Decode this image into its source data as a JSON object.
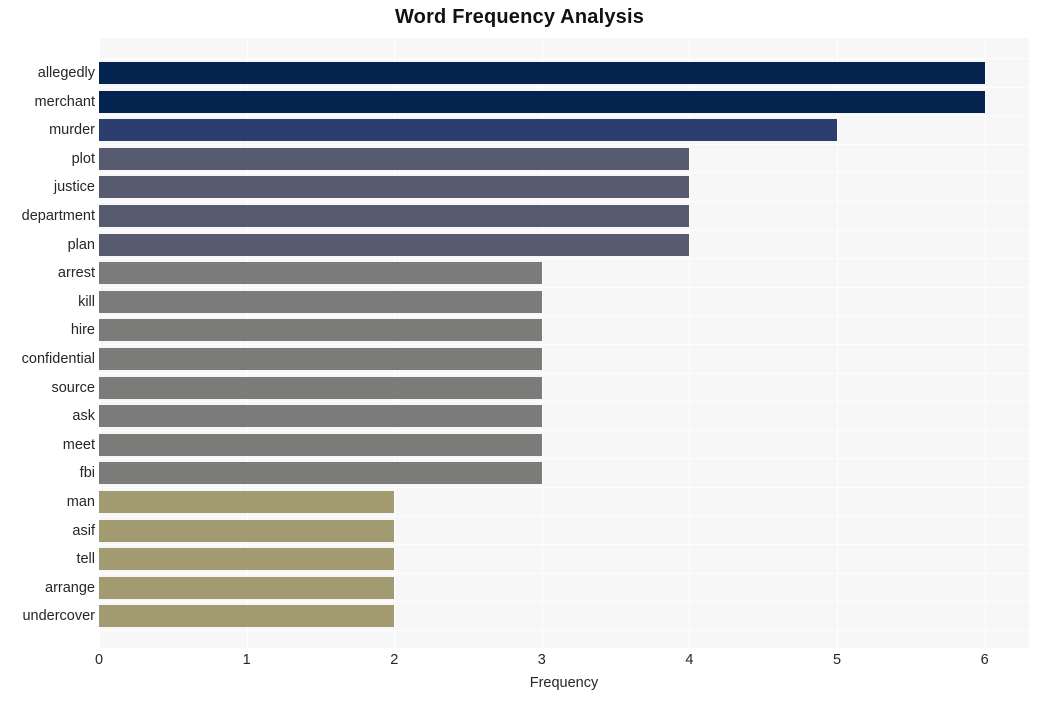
{
  "chart_data": {
    "type": "bar",
    "orientation": "horizontal",
    "title": "Word Frequency Analysis",
    "xlabel": "Frequency",
    "ylabel": "",
    "xlim": [
      0,
      6.3
    ],
    "xticks": [
      0,
      1,
      2,
      3,
      4,
      5,
      6
    ],
    "xtick_labels": [
      "0",
      "1",
      "2",
      "3",
      "4",
      "5",
      "6"
    ],
    "grid": true,
    "legend": "none",
    "categories": [
      "allegedly",
      "merchant",
      "murder",
      "plot",
      "justice",
      "department",
      "plan",
      "arrest",
      "kill",
      "hire",
      "confidential",
      "source",
      "ask",
      "meet",
      "fbi",
      "man",
      "asif",
      "tell",
      "arrange",
      "undercover"
    ],
    "values": [
      6,
      6,
      5,
      4,
      4,
      4,
      4,
      3,
      3,
      3,
      3,
      3,
      3,
      3,
      3,
      2,
      2,
      2,
      2,
      2
    ],
    "bar_colors": [
      "#04234f",
      "#04234f",
      "#2d3e6e",
      "#565b70",
      "#565b70",
      "#565b70",
      "#565b70",
      "#7b7b79",
      "#7b7b79",
      "#7b7b79",
      "#7b7b79",
      "#7b7b79",
      "#7b7b79",
      "#7b7b79",
      "#7b7b79",
      "#a29b72",
      "#a29b72",
      "#a29b72",
      "#a29b72",
      "#a29b72"
    ],
    "plot_background": "#f7f7f7",
    "grid_color": "#ffffff",
    "figure_background": "#ffffff",
    "text_color": "#262626"
  }
}
